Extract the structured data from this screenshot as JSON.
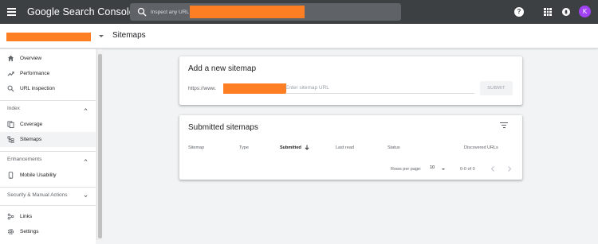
{
  "topbar": {
    "brand": "Google Search Console",
    "search_placeholder": "Inspect any URL",
    "avatar_letter": "K",
    "help_glyph": "?"
  },
  "subheader": {
    "page_title": "Sitemaps"
  },
  "sidebar": {
    "items_top": [
      {
        "label": "Overview",
        "icon": "home-icon"
      },
      {
        "label": "Performance",
        "icon": "trending-up-icon"
      },
      {
        "label": "URL inspection",
        "icon": "search-icon"
      }
    ],
    "section_index": {
      "label": "Index"
    },
    "items_index": [
      {
        "label": "Coverage",
        "icon": "coverage-icon"
      },
      {
        "label": "Sitemaps",
        "icon": "sitemap-icon",
        "active": true
      }
    ],
    "section_enhancements": {
      "label": "Enhancements"
    },
    "items_enhancements": [
      {
        "label": "Mobile Usability",
        "icon": "phone-icon"
      }
    ],
    "section_security": {
      "label": "Security & Manual Actions"
    },
    "items_bottom": [
      {
        "label": "Links",
        "icon": "links-icon"
      },
      {
        "label": "Settings",
        "icon": "gear-icon"
      }
    ]
  },
  "add_sitemap": {
    "title": "Add a new sitemap",
    "url_prefix": "https://www.",
    "input_placeholder": "Enter sitemap URL",
    "submit_label": "SUBMIT"
  },
  "submitted": {
    "title": "Submitted sitemaps",
    "columns": [
      "Sitemap",
      "Type",
      "Submitted",
      "Last read",
      "Status",
      "Discovered URLs"
    ],
    "rows_per_page_label": "Rows per page:",
    "rows_per_page_value": "10",
    "range_label": "0-0 of 0"
  },
  "colors": {
    "topbar": "#3c4043",
    "redaction": "#fd7e23",
    "avatar": "#a142f4"
  }
}
